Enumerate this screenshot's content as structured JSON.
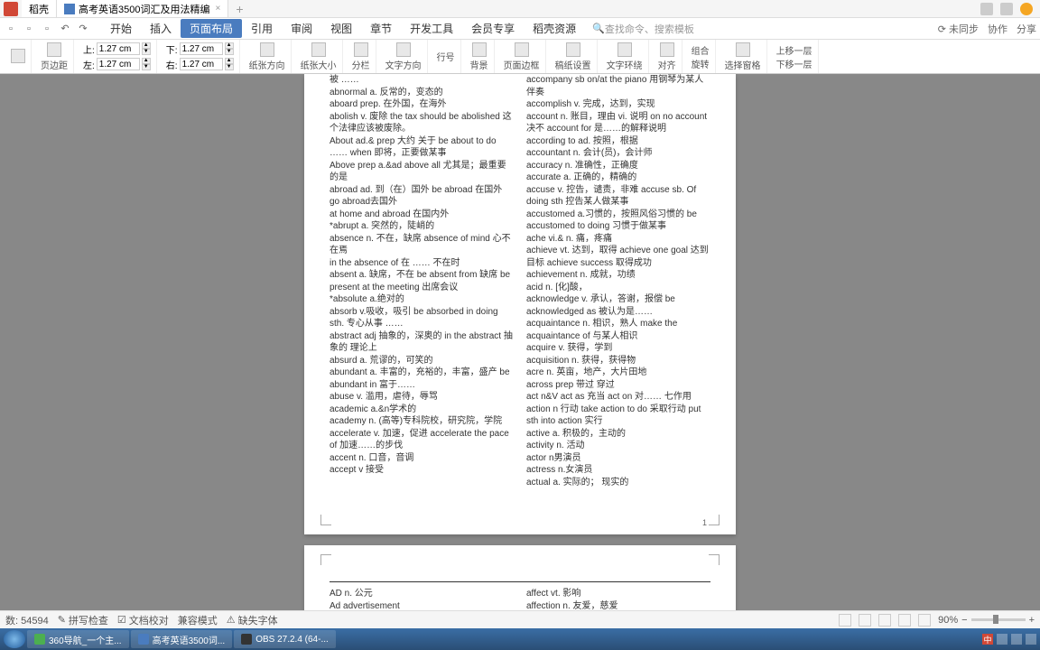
{
  "titlebar": {
    "app_name": "稻壳",
    "doc_title": "高考英语3500词汇及用法精编",
    "new_tab": "+"
  },
  "menu": {
    "tabs": [
      "开始",
      "插入",
      "页面布局",
      "引用",
      "审阅",
      "视图",
      "章节",
      "开发工具",
      "会员专享",
      "稻壳资源"
    ],
    "active_index": 2,
    "search_placeholder": "查找命令、搜索模板",
    "right": [
      "未同步",
      "协作",
      "分享"
    ]
  },
  "ribbon": {
    "margins_label": "页边距",
    "top_label": "上:",
    "bottom_label": "下:",
    "left_label": "左:",
    "right_label": "右:",
    "margin_value": "1.27 cm",
    "groups": [
      "纸张方向",
      "纸张大小",
      "分栏",
      "文字方向",
      "行号",
      "背景",
      "页面边框",
      "稿纸设置",
      "文字环绕",
      "对齐",
      "旋转",
      "选择窗格"
    ],
    "combo": "组合",
    "move_up": "上移一层",
    "move_down": "下移一层"
  },
  "page1": {
    "col1": [
      "被 ……",
      "abnormal a.  反常的，变态的",
      "aboard prep.  在外国，在海外",
      "abolish v. 废除    the tax should be abolished 这个法律应该被废除。",
      "About ad.& prep 大约 关于  be about to do …… when 即将，正要做某事",
      "Above prep a.&ad    above all 尤其是；最重要的是",
      "abroad ad. 到（在）国外  be abroad 在国外 go abroad去国外",
      "at home and abroad   在国内外",
      "*abrupt a. 突然的，陡峭的",
      "absence n. 不在，缺席  absence of mind 心不在焉",
      "in the absence of 在 …… 不在时",
      "absent a. 缺席，不在  be absent from 缺席  be present at the meeting 出席会议",
      "*absolute a.绝对的",
      "absorb v.吸收，吸引 be absorbed in doing sth. 专心从事 ……",
      "abstract adj 抽象的，深奥的  in the abstract 抽象的 理论上",
      "absurd a. 荒谬的，可笑的",
      "abundant a. 丰富的，充裕的，丰富，盛产 be abundant in 富于……",
      "abuse v. 滥用，虐待，辱骂",
      "academic a.&n学术的",
      "academy n. (高等)专科院校，研究院，学院",
      "accelerate v. 加速，促进 accelerate the pace of 加速……的步伐",
      "accent n. 口音，音调",
      "accept v 接受"
    ],
    "col2": [
      "accompany sb on/at the piano 用钢琴为某人伴奏",
      "accomplish v. 完成，达到，实现",
      "account n. 账目，理由  vi. 说明 on no account 决不  account for 是……的解释说明",
      "according to ad. 按照，根据",
      "accountant n. 会计(员)，会计师",
      "accuracy n. 准确性，正确度",
      "accurate a. 正确的，精确的",
      "accuse v. 控告，谴责，非难   accuse sb. Of doing sth 控告某人做某事",
      "accustomed a.习惯的，按照风俗习惯的 be accustomed to doing 习惯于做某事",
      "ache vi.& n. 痛，疼痛",
      "achieve vt. 达到，取得   achieve one goal 达到目标  achieve success 取得成功",
      "achievement n. 成就，功绩",
      "acid n. [化]酸，",
      "acknowledge v. 承认，答谢，报偿    be acknowledged as 被认为是……",
      "acquaintance n. 相识，熟人     make the acquaintance of 与某人相识",
      "acquire v. 获得，学到",
      "acquisition n. 获得，获得物",
      "acre n. 英亩，地产，大片田地",
      "across prep 带过 穿过",
      "act n&V act as 充当  act on 对…… 七作用",
      "action n 行动  take action to do 采取行动   put sth into action 实行",
      "active a. 积极的，主动的",
      "activity n. 活动",
      "actor n男演员",
      "actress n.女演员",
      "actual a. 实际的； 现实的"
    ],
    "page_num": "1"
  },
  "page2": {
    "col1": [
      "AD  n. 公元",
      "Ad advertisement"
    ],
    "col2": [
      "affect vt. 影响",
      "affection n. 友爱，慈爱"
    ]
  },
  "statusbar": {
    "word_count": "数: 54594",
    "spell": "拼写检查",
    "proof": "文档校对",
    "compat": "兼容模式",
    "missing_font": "缺失字体",
    "zoom": "90%"
  },
  "taskbar": {
    "items": [
      "360导航_一个主...",
      "高考英语3500词...",
      "OBS 27.2.4 (64-..."
    ],
    "time": "",
    "lang": "中"
  }
}
